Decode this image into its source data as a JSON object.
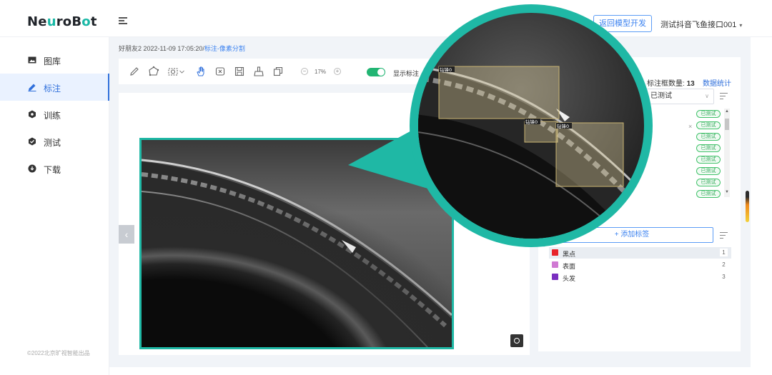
{
  "header": {
    "logo_prefix": "Ne",
    "logo_o1": "u",
    "logo_mid": "ro",
    "logo_tail": "B",
    "logo_o2": "o",
    "logo_end": "t",
    "back_button": "返回模型开发",
    "user_name": "测试抖音飞鱼接口001",
    "user_caret": "▾"
  },
  "sidebar": {
    "items": [
      {
        "label": "图库",
        "icon": "image-icon"
      },
      {
        "label": "标注",
        "icon": "pencil-icon"
      },
      {
        "label": "训练",
        "icon": "train-icon"
      },
      {
        "label": "测试",
        "icon": "test-icon"
      },
      {
        "label": "下载",
        "icon": "download-icon"
      }
    ],
    "active_index": 1,
    "copyright": "©2022北京旷视智能出品"
  },
  "breadcrumb": {
    "prefix": "好朋友2 2022-11-09 17:05:20/",
    "link": "标注-像素分割"
  },
  "toolbar": {
    "zoom": "17%",
    "zoom_minus": "−",
    "zoom_plus": "+",
    "show_label": "显示标注"
  },
  "canvas": {
    "prev_arrow": "‹"
  },
  "right_panel": {
    "count_label": "标注框数量:",
    "count_value": "13",
    "stats_link": "数据统计",
    "filter_value": "已测试",
    "filter_arrow": "∨",
    "row_close": "×",
    "status_tags": [
      "已测试",
      "已测试",
      "已测试",
      "已测试",
      "已测试",
      "已测试",
      "已测试",
      "已测试"
    ],
    "add_label_button": "+ 添加标签",
    "labels": [
      {
        "name": "黑点",
        "count": "1",
        "color": "#e8232a"
      },
      {
        "name": "表面",
        "count": "2",
        "color": "#d07ad3"
      },
      {
        "name": "头发",
        "count": "3",
        "color": "#7a2fc0"
      }
    ]
  },
  "magnifier": {
    "box_labels": [
      "钻锋0",
      "钻锋0",
      "钻锋0"
    ]
  },
  "colors": {
    "accent": "#2f6fdb",
    "teal": "#1fb8a5",
    "success": "#22b573"
  }
}
